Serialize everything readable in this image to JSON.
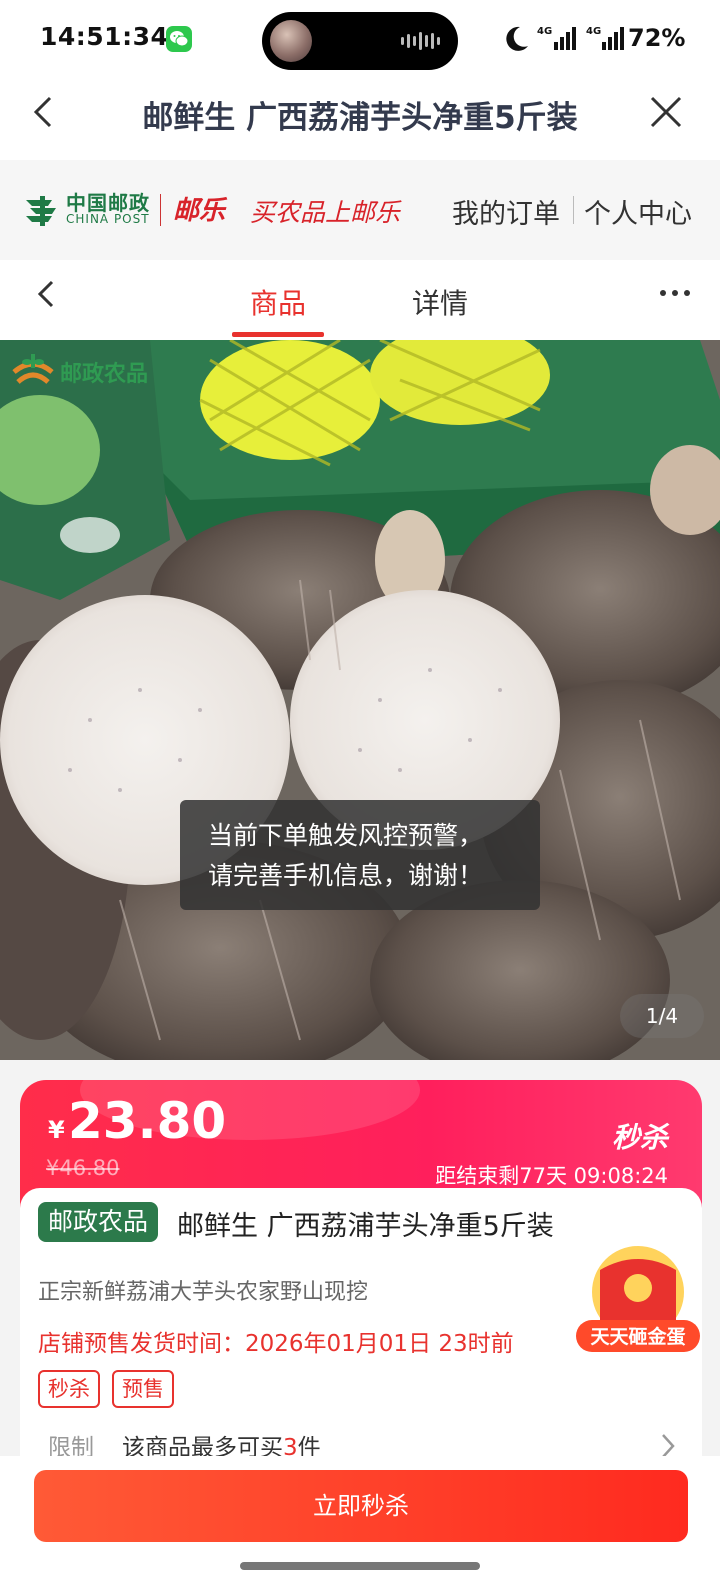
{
  "status_bar": {
    "time": "14:51:34",
    "network_1": "4G",
    "network_2": "4G",
    "battery": "72%",
    "icons": [
      "wechat-icon",
      "moon-icon",
      "signal-icon",
      "battery-icon"
    ]
  },
  "header": {
    "title": "邮鲜生 广西荔浦芋头净重5斤装"
  },
  "brand": {
    "chinapost_cn": "中国邮政",
    "chinapost_en": "CHINA POST",
    "youle": "邮乐",
    "slogan": "买农品上邮乐",
    "my_orders": "我的订单",
    "user_center": "个人中心"
  },
  "tabs": [
    {
      "label": "商品",
      "active": true
    },
    {
      "label": "详情",
      "active": false
    }
  ],
  "gallery": {
    "watermark": "邮政农品",
    "toast_line1": "当前下单触发风控预警，",
    "toast_line2": "请完善手机信息，谢谢！",
    "page_indicator": "1/4"
  },
  "price": {
    "currency": "¥",
    "current": "23.80",
    "original": "¥46.80",
    "promo_label": "秒杀",
    "countdown": "距结束剩77天 09:08:24"
  },
  "product": {
    "shop_badge": "邮政农品",
    "name": "邮鲜生 广西荔浦芋头净重5斤装",
    "subtitle": "正宗新鲜荔浦大芋头农家野山现挖",
    "ship_time": "店铺预售发货时间：2026年01月01日 23时前",
    "tags": [
      "秒杀",
      "预售"
    ],
    "limit_label": "限制",
    "limit_prefix": "该商品最多可买",
    "limit_count": "3",
    "limit_suffix": "件",
    "egg_badge": "天天砸金蛋"
  },
  "buy_bar": {
    "button": "立即秒杀"
  },
  "colors": {
    "accent_red": "#e8322e",
    "price_gradient_start": "#ff2d4a",
    "post_green": "#2c7a4b"
  }
}
